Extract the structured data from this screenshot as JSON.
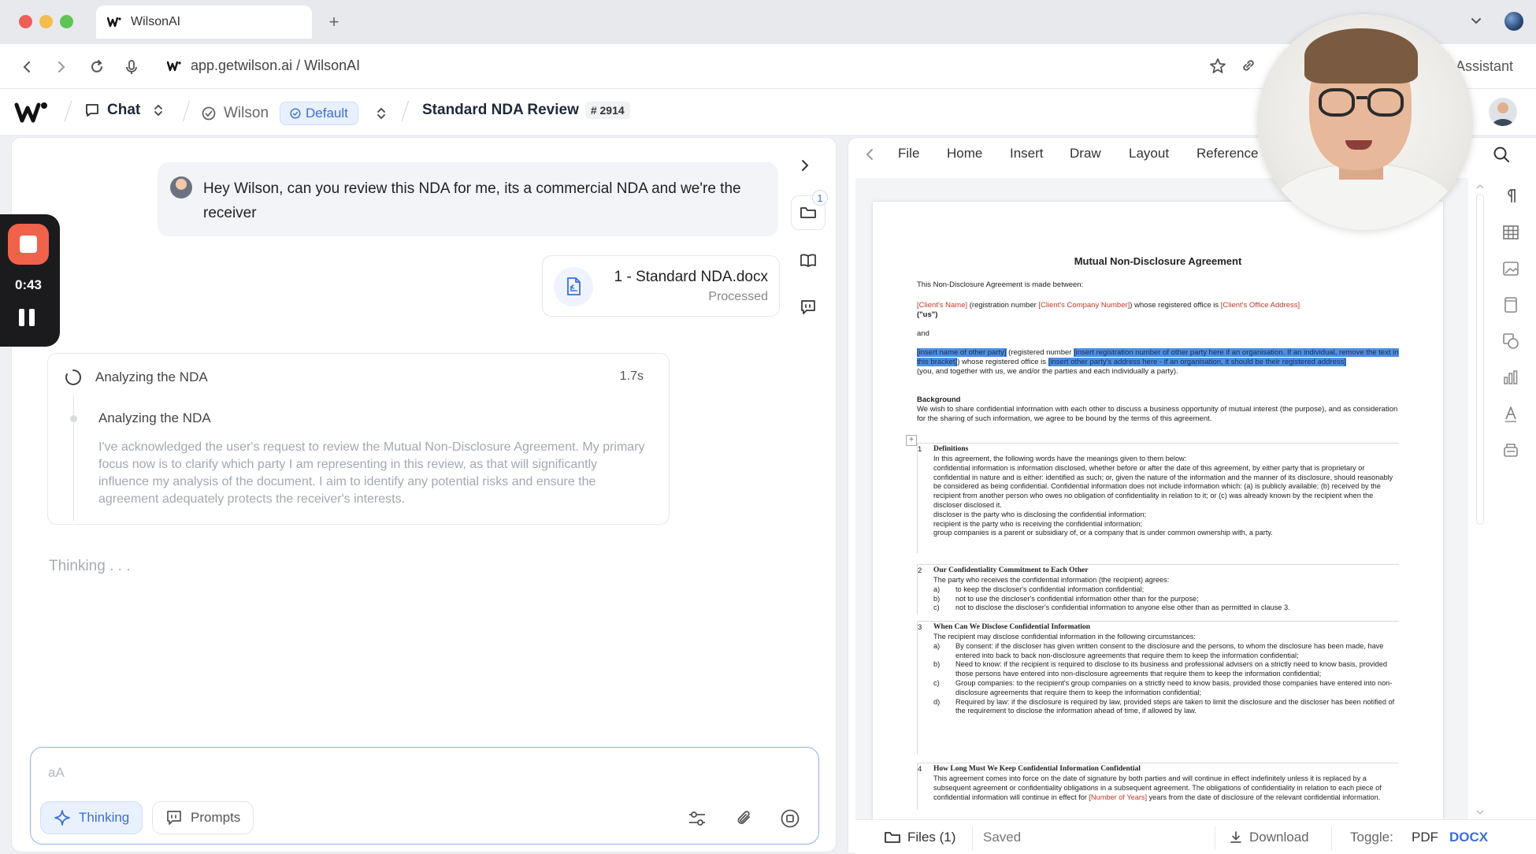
{
  "browser": {
    "tab_title": "WilsonAI",
    "new_tab": "+",
    "url": "app.getwilson.ai / WilsonAI",
    "assistant_label": "Assistant"
  },
  "header": {
    "chat_label": "Chat",
    "agent_label": "Wilson",
    "mode_label": "Default",
    "doc_title": "Standard NDA Review",
    "doc_number": "# 2914"
  },
  "chat": {
    "user_message": "Hey Wilson, can you review this NDA for me, its a commercial NDA and we're the receiver",
    "file": {
      "name": "1 - Standard NDA.docx",
      "status": "Processed",
      "count": "1"
    },
    "analysis": {
      "title": "Analyzing the NDA",
      "time": "1.7s",
      "step_title": "Analyzing the NDA",
      "step_body": "I've acknowledged the user's request to review the Mutual Non-Disclosure Agreement. My primary focus now is to clarify which party I am representing in this review, as that will significantly influence my analysis of the document. I aim to identify any potential risks and ensure the agreement adequately protects the receiver's interests."
    },
    "thinking_status": "Thinking . . ."
  },
  "recorder": {
    "time": "0:43"
  },
  "composer": {
    "placeholder": "aA",
    "thinking_label": "Thinking",
    "prompts_label": "Prompts"
  },
  "doc": {
    "ribbon": [
      "File",
      "Home",
      "Insert",
      "Draw",
      "Layout",
      "Reference"
    ],
    "title": "Mutual Non-Disclosure Agreement",
    "intro": "This Non-Disclosure Agreement is made between:",
    "client_name": "[Client's Name]",
    "reg_number_text": " (registration number ",
    "client_company_number": "[Client's Company Number]",
    "office_text": ") whose registered office is ",
    "client_office": "[Client's Office Address]",
    "us_text": "(\"us\")",
    "and_text": "and",
    "other_party_name": "[insert name of other party]",
    "other_reg_text": " (registered number ",
    "other_reg": "[insert registration number of other party here if an organisation. If an individual, remove the text in this bracket]",
    "other_office_text": ") whose registered office is ",
    "other_office": "[insert other party's address here - if an organisation, it should be their registered address]",
    "parties_text": "(you, and together with us, we and/or the parties and each individually a party).",
    "background_h": "Background",
    "background_b": "We wish to share confidential information with each other to discuss a business opportunity of mutual interest (the purpose), and as consideration for the sharing of such information, we agree to be bound by the terms of this agreement.",
    "sections": [
      {
        "n": "1",
        "h": "Definitions",
        "b1": "In this agreement, the following words have the meanings given to them below:",
        "b2": "confidential information is information disclosed, whether before or after the date of this agreement, by either party that is proprietary or confidential in nature and is either: identified as such; or, given the nature of the information and the manner of its disclosure, should reasonably be considered as being confidential. Confidential information does not include information which: (a) is publicly available; (b) received by the recipient from another person who owes no obligation of confidentiality in relation to it; or (c) was already known by the recipient when the discloser disclosed it.",
        "b3": "discloser is the party who is disclosing the confidential information;",
        "b4": "recipient is the party who is receiving the confidential information;",
        "b5": "group companies is a parent or subsidiary of, or a company that is under common ownership with, a party."
      },
      {
        "n": "2",
        "h": "Our Confidentiality Commitment to Each Other",
        "b1": "The party who receives the confidential information (the recipient) agrees:",
        "items": [
          {
            "k": "a)",
            "t": "to keep the discloser's confidential information confidential;"
          },
          {
            "k": "b)",
            "t": "not to use the discloser's confidential information other than for the purpose;"
          },
          {
            "k": "c)",
            "t": "not to disclose the discloser's confidential information to anyone else other than as permitted in clause 3."
          }
        ]
      },
      {
        "n": "3",
        "h": "When Can We Disclose Confidential Information",
        "b1": "The recipient may disclose confidential information in the following circumstances:",
        "items": [
          {
            "k": "a)",
            "t": "By consent: if the discloser has given written consent to the disclosure and the persons, to whom the disclosure has been made, have entered into back to back non-disclosure agreements that require them to keep the information confidential;"
          },
          {
            "k": "b)",
            "t": "Need to know: if the recipient is required to disclose to its business and professional advisers on a strictly need to know basis, provided those persons have entered into non-disclosure agreements that require them to keep the information confidential;"
          },
          {
            "k": "c)",
            "t": "Group companies: to the recipient's group companies on a strictly need to know basis, provided those companies have entered into non-disclosure agreements that require them to keep the information confidential;"
          },
          {
            "k": "d)",
            "t": "Required by law: if the disclosure is required by law, provided steps are taken to limit the disclosure and the discloser has been notified of the requirement to disclose the information ahead of time, if allowed by law."
          }
        ]
      },
      {
        "n": "4",
        "h": "How Long Must We Keep Confidential Information Confidential",
        "b1": "This agreement comes into force on the date of signature by both parties and will continue in effect indefinitely unless it is replaced by a subsequent agreement or confidentiality obligations in a subsequent agreement. The obligations of confidentiality in relation to each piece of confidential information will continue in effect for",
        "b2": "[Number of Years]",
        "b3": " years from the date of disclosure of the relevant confidential information."
      }
    ]
  },
  "doc_footer": {
    "files_label": "Files (1)",
    "saved_label": "Saved",
    "download_label": "Download",
    "toggle_label": "Toggle:",
    "pdf_label": "PDF",
    "docx_label": "DOCX"
  },
  "colors": {
    "accent": "#3b6fd9",
    "record": "#f0624a",
    "highlight": "#4d8fe0",
    "placeholder_red": "#c0392b"
  }
}
